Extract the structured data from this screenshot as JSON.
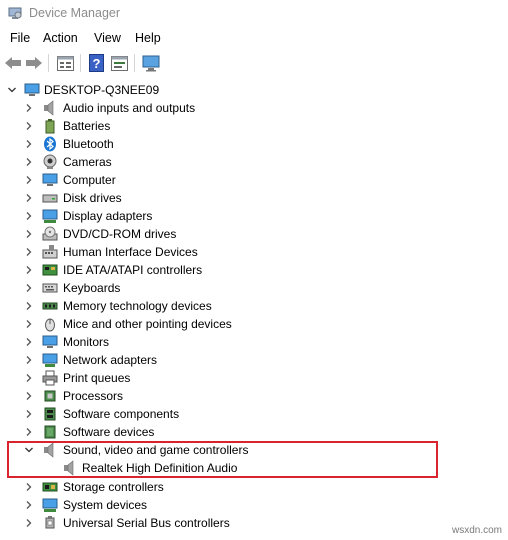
{
  "window": {
    "title": "Device Manager",
    "icon": "device-manager-icon"
  },
  "menu": [
    "File",
    "Action",
    "View",
    "Help"
  ],
  "toolbar": {
    "buttons": [
      "back-arrow-icon",
      "forward-arrow-icon",
      "properties-icon",
      "help-icon",
      "show-view-icon",
      "scan-monitor-icon"
    ]
  },
  "tree": {
    "root": {
      "label": "DESKTOP-Q3NEE09",
      "expanded": true,
      "icon": "computer-icon"
    },
    "categories": [
      {
        "label": "Audio inputs and outputs",
        "icon": "speaker-icon"
      },
      {
        "label": "Batteries",
        "icon": "battery-icon"
      },
      {
        "label": "Bluetooth",
        "icon": "bluetooth-icon"
      },
      {
        "label": "Cameras",
        "icon": "camera-icon"
      },
      {
        "label": "Computer",
        "icon": "monitor-icon"
      },
      {
        "label": "Disk drives",
        "icon": "disk-drive-icon"
      },
      {
        "label": "Display adapters",
        "icon": "display-adapter-icon"
      },
      {
        "label": "DVD/CD-ROM drives",
        "icon": "optical-drive-icon"
      },
      {
        "label": "Human Interface Devices",
        "icon": "hid-icon"
      },
      {
        "label": "IDE ATA/ATAPI controllers",
        "icon": "ide-controller-icon"
      },
      {
        "label": "Keyboards",
        "icon": "keyboard-icon"
      },
      {
        "label": "Memory technology devices",
        "icon": "memory-icon"
      },
      {
        "label": "Mice and other pointing devices",
        "icon": "mouse-icon"
      },
      {
        "label": "Monitors",
        "icon": "monitor-icon"
      },
      {
        "label": "Network adapters",
        "icon": "network-adapter-icon"
      },
      {
        "label": "Print queues",
        "icon": "printer-icon"
      },
      {
        "label": "Processors",
        "icon": "processor-icon"
      },
      {
        "label": "Software components",
        "icon": "software-component-icon"
      },
      {
        "label": "Software devices",
        "icon": "software-device-icon"
      },
      {
        "label": "Sound, video and game controllers",
        "icon": "speaker-icon",
        "expanded": true,
        "children": [
          {
            "label": "Realtek High Definition Audio",
            "icon": "speaker-icon"
          }
        ]
      },
      {
        "label": "Storage controllers",
        "icon": "storage-controller-icon"
      },
      {
        "label": "System devices",
        "icon": "system-device-icon"
      },
      {
        "label": "Universal Serial Bus controllers",
        "icon": "usb-icon"
      }
    ]
  },
  "highlight_color": "#d9232e",
  "watermark": "wsxdn.com"
}
